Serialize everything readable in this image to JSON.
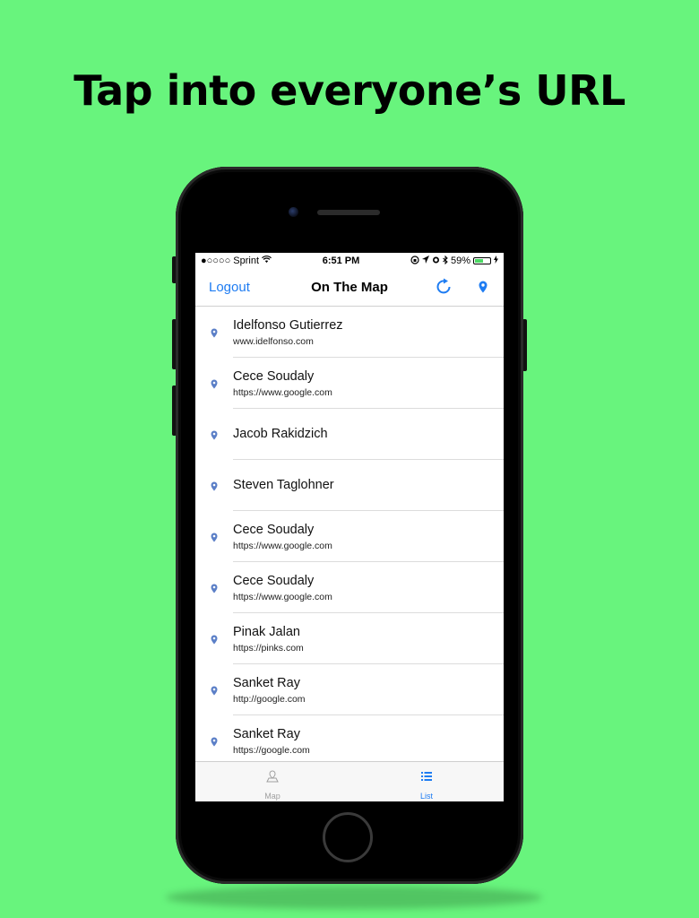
{
  "headline": "Tap into everyone’s URL",
  "status_bar": {
    "carrier": "●○○○○ Sprint",
    "time": "6:51 PM",
    "battery": "59%",
    "battery_level": 0.59
  },
  "navbar": {
    "left_button": "Logout",
    "title": "On The Map",
    "icons": [
      "refresh-icon",
      "pin-icon"
    ]
  },
  "students": [
    {
      "name": "Idelfonso Gutierrez",
      "url": "www.idelfonso.com"
    },
    {
      "name": "Cece Soudaly",
      "url": "https://www.google.com"
    },
    {
      "name": "Jacob Rakidzich",
      "url": ""
    },
    {
      "name": "Steven Taglohner",
      "url": ""
    },
    {
      "name": "Cece Soudaly",
      "url": "https://www.google.com"
    },
    {
      "name": "Cece Soudaly",
      "url": "https://www.google.com"
    },
    {
      "name": "Pinak Jalan",
      "url": "https://pinks.com"
    },
    {
      "name": "Sanket Ray",
      "url": "http://google.com"
    },
    {
      "name": "Sanket Ray",
      "url": "https://google.com"
    }
  ],
  "tabbar": {
    "tabs": [
      {
        "label": "Map",
        "icon": "map-icon",
        "selected": false
      },
      {
        "label": "List",
        "icon": "list-icon",
        "selected": true
      }
    ]
  },
  "colors": {
    "background": "#68f47d",
    "accent": "#1e7cf2",
    "inactive_tab": "#a0a0a0"
  }
}
